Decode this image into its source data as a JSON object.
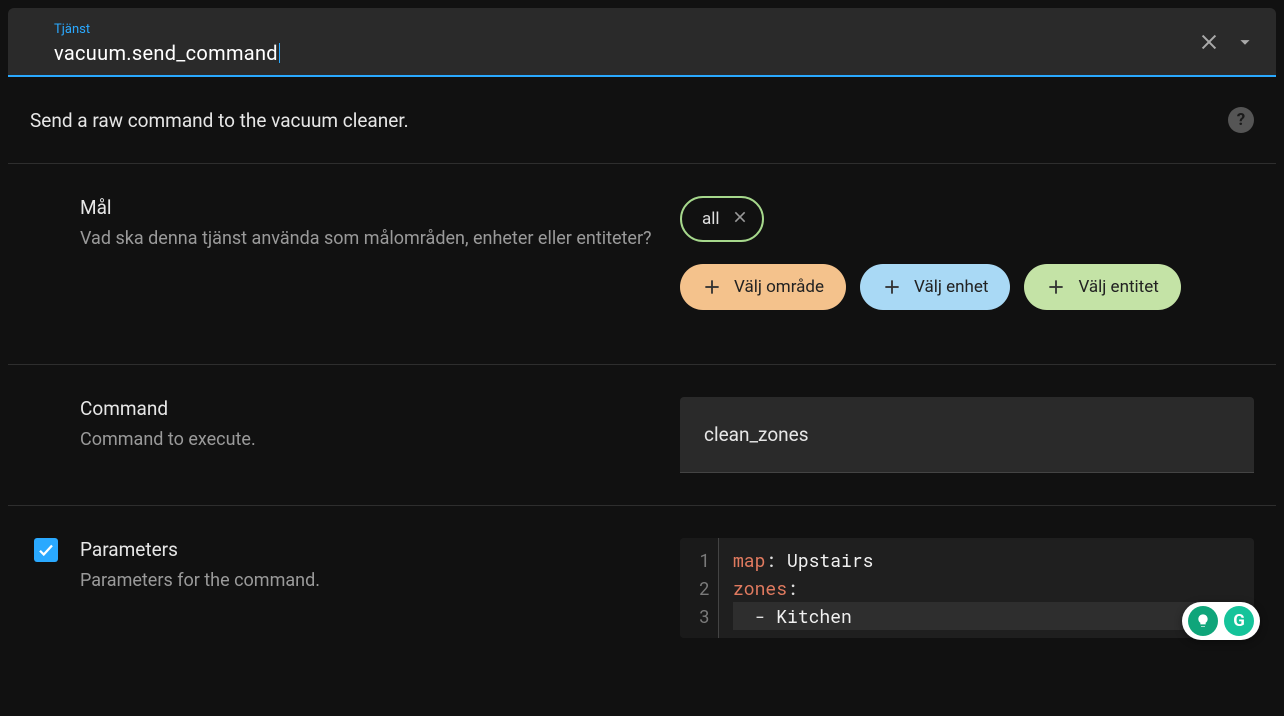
{
  "service": {
    "label": "Tjänst",
    "value": "vacuum.send_command"
  },
  "description": "Send a raw command to the vacuum cleaner.",
  "targets": {
    "title": "Mål",
    "description": "Vad ska denna tjänst använda som målområden, enheter eller entiteter?",
    "selected": [
      {
        "label": "all"
      }
    ],
    "pickers": {
      "area": "Välj område",
      "device": "Välj enhet",
      "entity": "Välj entitet"
    }
  },
  "command": {
    "title": "Command",
    "description": "Command to execute.",
    "value": "clean_zones"
  },
  "parameters": {
    "enabled": true,
    "title": "Parameters",
    "description": "Parameters for the command.",
    "code": {
      "lines": [
        {
          "n": "1",
          "key": "map",
          "sep": ": ",
          "val": "Upstairs"
        },
        {
          "n": "2",
          "key": "zones",
          "sep": ":",
          "val": ""
        },
        {
          "n": "3",
          "key": "",
          "sep": "  - ",
          "val": "Kitchen"
        }
      ]
    }
  },
  "icons": {
    "close": "close-icon",
    "chevron": "chevron-down-icon",
    "help": "?",
    "plus": "+",
    "check": "✓",
    "bulb": "💡",
    "g": "G"
  }
}
